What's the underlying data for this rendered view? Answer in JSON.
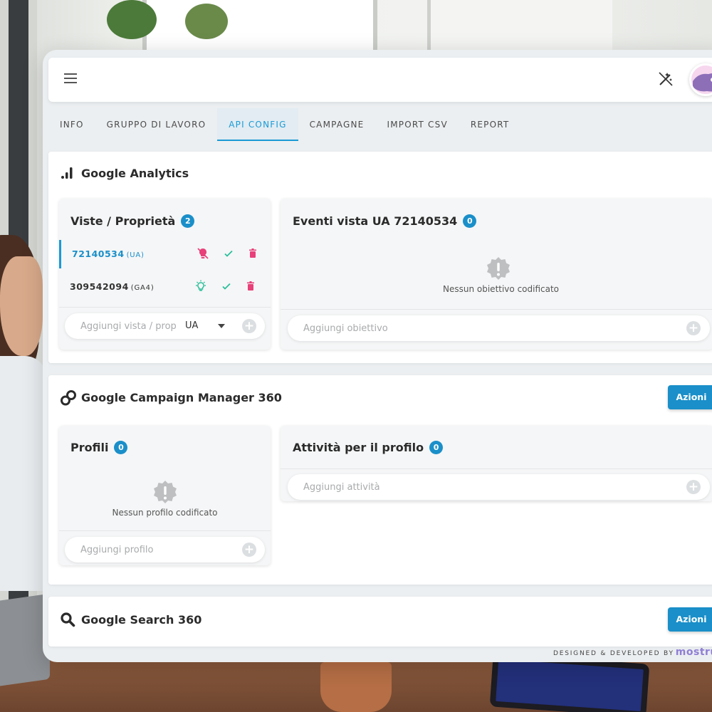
{
  "tabs": [
    "INFO",
    "GRUPPO DI LAVORO",
    "API CONFIG",
    "CAMPAGNE",
    "IMPORT CSV",
    "REPORT"
  ],
  "active_tab": "API CONFIG",
  "analytics": {
    "title": "Google Analytics",
    "views_card": {
      "title": "Viste / Proprietà",
      "count": "2",
      "items": [
        {
          "id": "72140534",
          "type": "(UA)"
        },
        {
          "id": "309542094",
          "type": "(GA4)"
        }
      ],
      "add_placeholder": "Aggiungi vista / prop",
      "select_value": "UA"
    },
    "events_card": {
      "title": "Eventi vista UA 72140534",
      "count": "0",
      "empty_text": "Nessun obiettivo codificato",
      "add_placeholder": "Aggiungi obiettivo"
    }
  },
  "campaign_manager": {
    "title": "Google Campaign Manager 360",
    "actions_label": "Azioni",
    "profiles_card": {
      "title": "Profili",
      "count": "0",
      "empty_text": "Nessun profilo codificato",
      "add_placeholder": "Aggiungi profilo"
    },
    "activities_card": {
      "title": "Attività per il profilo",
      "count": "0",
      "add_placeholder": "Aggiungi attività"
    }
  },
  "search360": {
    "title": "Google Search 360",
    "actions_label": "Azioni"
  },
  "footer": {
    "text": "DESIGNED & DEVELOPED BY",
    "brand": "mostru"
  },
  "colors": {
    "accent": "#1a8fc9",
    "danger": "#e8407a",
    "success": "#2bbf9b"
  }
}
